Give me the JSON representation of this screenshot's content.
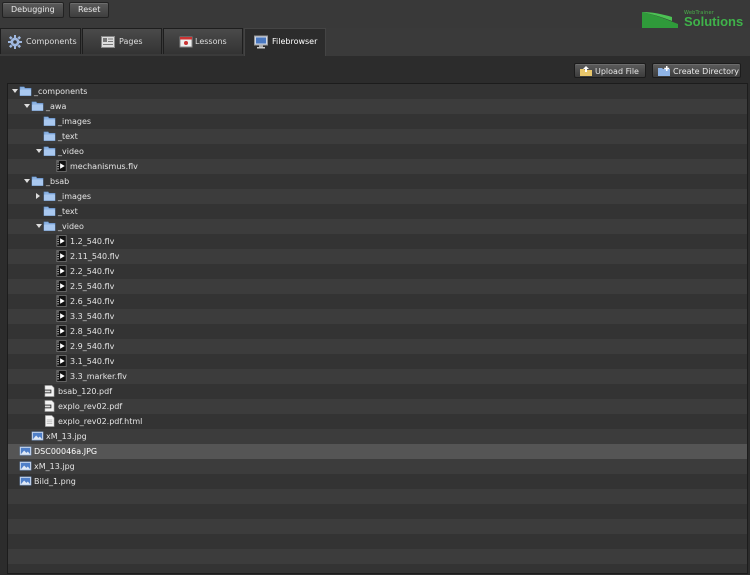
{
  "toolbar": {
    "debug_label": "Debugging",
    "reset_label": "Reset"
  },
  "logo": {
    "small": "WebTrainer",
    "big": "Solutions",
    "color": "#3fb24a"
  },
  "tabs": [
    {
      "label": "Components",
      "icon": "gear-icon"
    },
    {
      "label": "Pages",
      "icon": "pages-icon"
    },
    {
      "label": "Lessons",
      "icon": "lessons-icon"
    },
    {
      "label": "Filebrowser",
      "icon": "monitor-icon",
      "active": true
    }
  ],
  "actions": {
    "upload_label": "Upload File",
    "mkdir_label": "Create Directory"
  },
  "tree": [
    {
      "label": "_components",
      "type": "folder",
      "depth": 0,
      "toggle": "open"
    },
    {
      "label": "_awa",
      "type": "folder",
      "depth": 1,
      "toggle": "open"
    },
    {
      "label": "_images",
      "type": "folder",
      "depth": 2
    },
    {
      "label": "_text",
      "type": "folder",
      "depth": 2
    },
    {
      "label": "_video",
      "type": "folder",
      "depth": 2,
      "toggle": "open"
    },
    {
      "label": "mechanismus.flv",
      "type": "video",
      "depth": 3
    },
    {
      "label": "_bsab",
      "type": "folder",
      "depth": 1,
      "toggle": "open"
    },
    {
      "label": "_images",
      "type": "folder",
      "depth": 2,
      "toggle": "closed"
    },
    {
      "label": "_text",
      "type": "folder",
      "depth": 2
    },
    {
      "label": "_video",
      "type": "folder",
      "depth": 2,
      "toggle": "open"
    },
    {
      "label": "1.2_540.flv",
      "type": "video",
      "depth": 3
    },
    {
      "label": "2.11_540.flv",
      "type": "video",
      "depth": 3
    },
    {
      "label": "2.2_540.flv",
      "type": "video",
      "depth": 3
    },
    {
      "label": "2.5_540.flv",
      "type": "video",
      "depth": 3
    },
    {
      "label": "2.6_540.flv",
      "type": "video",
      "depth": 3
    },
    {
      "label": "3.3_540.flv",
      "type": "video",
      "depth": 3
    },
    {
      "label": "2.8_540.flv",
      "type": "video",
      "depth": 3
    },
    {
      "label": "2.9_540.flv",
      "type": "video",
      "depth": 3
    },
    {
      "label": "3.1_540.flv",
      "type": "video",
      "depth": 3
    },
    {
      "label": "3.3_marker.flv",
      "type": "video",
      "depth": 3
    },
    {
      "label": "bsab_120.pdf",
      "type": "pdf",
      "depth": 2
    },
    {
      "label": "explo_rev02.pdf",
      "type": "pdf",
      "depth": 2
    },
    {
      "label": "explo_rev02.pdf.html",
      "type": "doc",
      "depth": 2
    },
    {
      "label": "xM_13.jpg",
      "type": "image",
      "depth": 1
    },
    {
      "label": "DSC00046a.JPG",
      "type": "image",
      "depth": 0,
      "selected": true
    },
    {
      "label": "xM_13.jpg",
      "type": "image",
      "depth": 0
    },
    {
      "label": "Bild_1.png",
      "type": "image",
      "depth": 0
    }
  ]
}
